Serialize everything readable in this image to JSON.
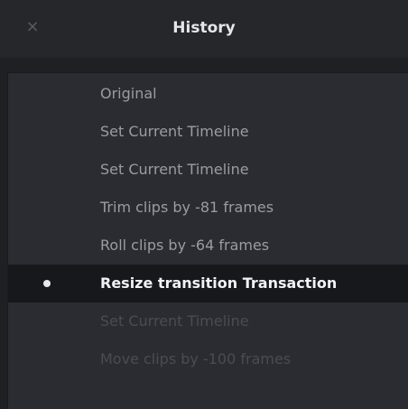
{
  "window": {
    "title": "History",
    "close_glyph": "×"
  },
  "history": {
    "items": [
      {
        "label": "Original",
        "state": "done"
      },
      {
        "label": "Set Current Timeline",
        "state": "done"
      },
      {
        "label": "Set Current Timeline",
        "state": "done"
      },
      {
        "label": "Trim clips by -81 frames",
        "state": "done"
      },
      {
        "label": "Roll clips by -64 frames",
        "state": "done"
      },
      {
        "label": "Resize transition Transaction",
        "state": "current"
      },
      {
        "label": "Set Current Timeline",
        "state": "undone"
      },
      {
        "label": "Move clips by -100 frames",
        "state": "undone"
      }
    ]
  },
  "icons": {
    "close": "close-icon",
    "current_marker": "bullet-icon"
  },
  "colors": {
    "background": "#1f2024",
    "titlebar": "#26272b",
    "panel": "#2a2c31",
    "current_row": "#17181b",
    "text_done": "#9b9ca3",
    "text_current": "#f2f2f4",
    "text_undone": "#4a4c53"
  }
}
